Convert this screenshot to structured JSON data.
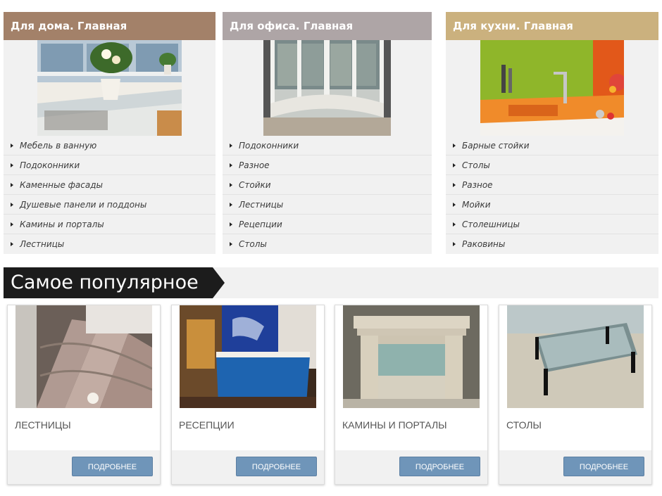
{
  "categories": [
    {
      "title": "Для дома. Главная",
      "color": "#a38169",
      "image_icon": "window-sill-flowers-image",
      "items": [
        "Мебель в ванную",
        "Подоконники",
        "Каменные фасады",
        "Душевые панели и поддоны",
        "Камины и порталы",
        "Лестницы"
      ]
    },
    {
      "title": "Для офиса. Главная",
      "color": "#aea5a6",
      "image_icon": "bay-window-image",
      "items": [
        "Подоконники",
        "Разное",
        "Стойки",
        "Лестницы",
        "Рецепции",
        "Столы"
      ]
    },
    {
      "title": "Для кухни. Главная",
      "color": "#cbb17e",
      "image_icon": "kitchen-counter-image",
      "items": [
        "Барные стойки",
        "Столы",
        "Разное",
        "Мойки",
        "Столешницы",
        "Раковины"
      ]
    }
  ],
  "popular": {
    "title": "Самое популярное",
    "cards": [
      {
        "title": "ЛЕСТНИЦЫ",
        "button": "ПОДРОБНЕЕ",
        "image_icon": "spiral-staircase-image"
      },
      {
        "title": "РЕСЕПЦИИ",
        "button": "ПОДРОБНЕЕ",
        "image_icon": "reception-desk-image"
      },
      {
        "title": "КАМИНЫ И ПОРТАЛЫ",
        "button": "ПОДРОБНЕЕ",
        "image_icon": "fireplace-portal-image"
      },
      {
        "title": "СТОЛЫ",
        "button": "ПОДРОБНЕЕ",
        "image_icon": "glass-table-image"
      }
    ]
  }
}
